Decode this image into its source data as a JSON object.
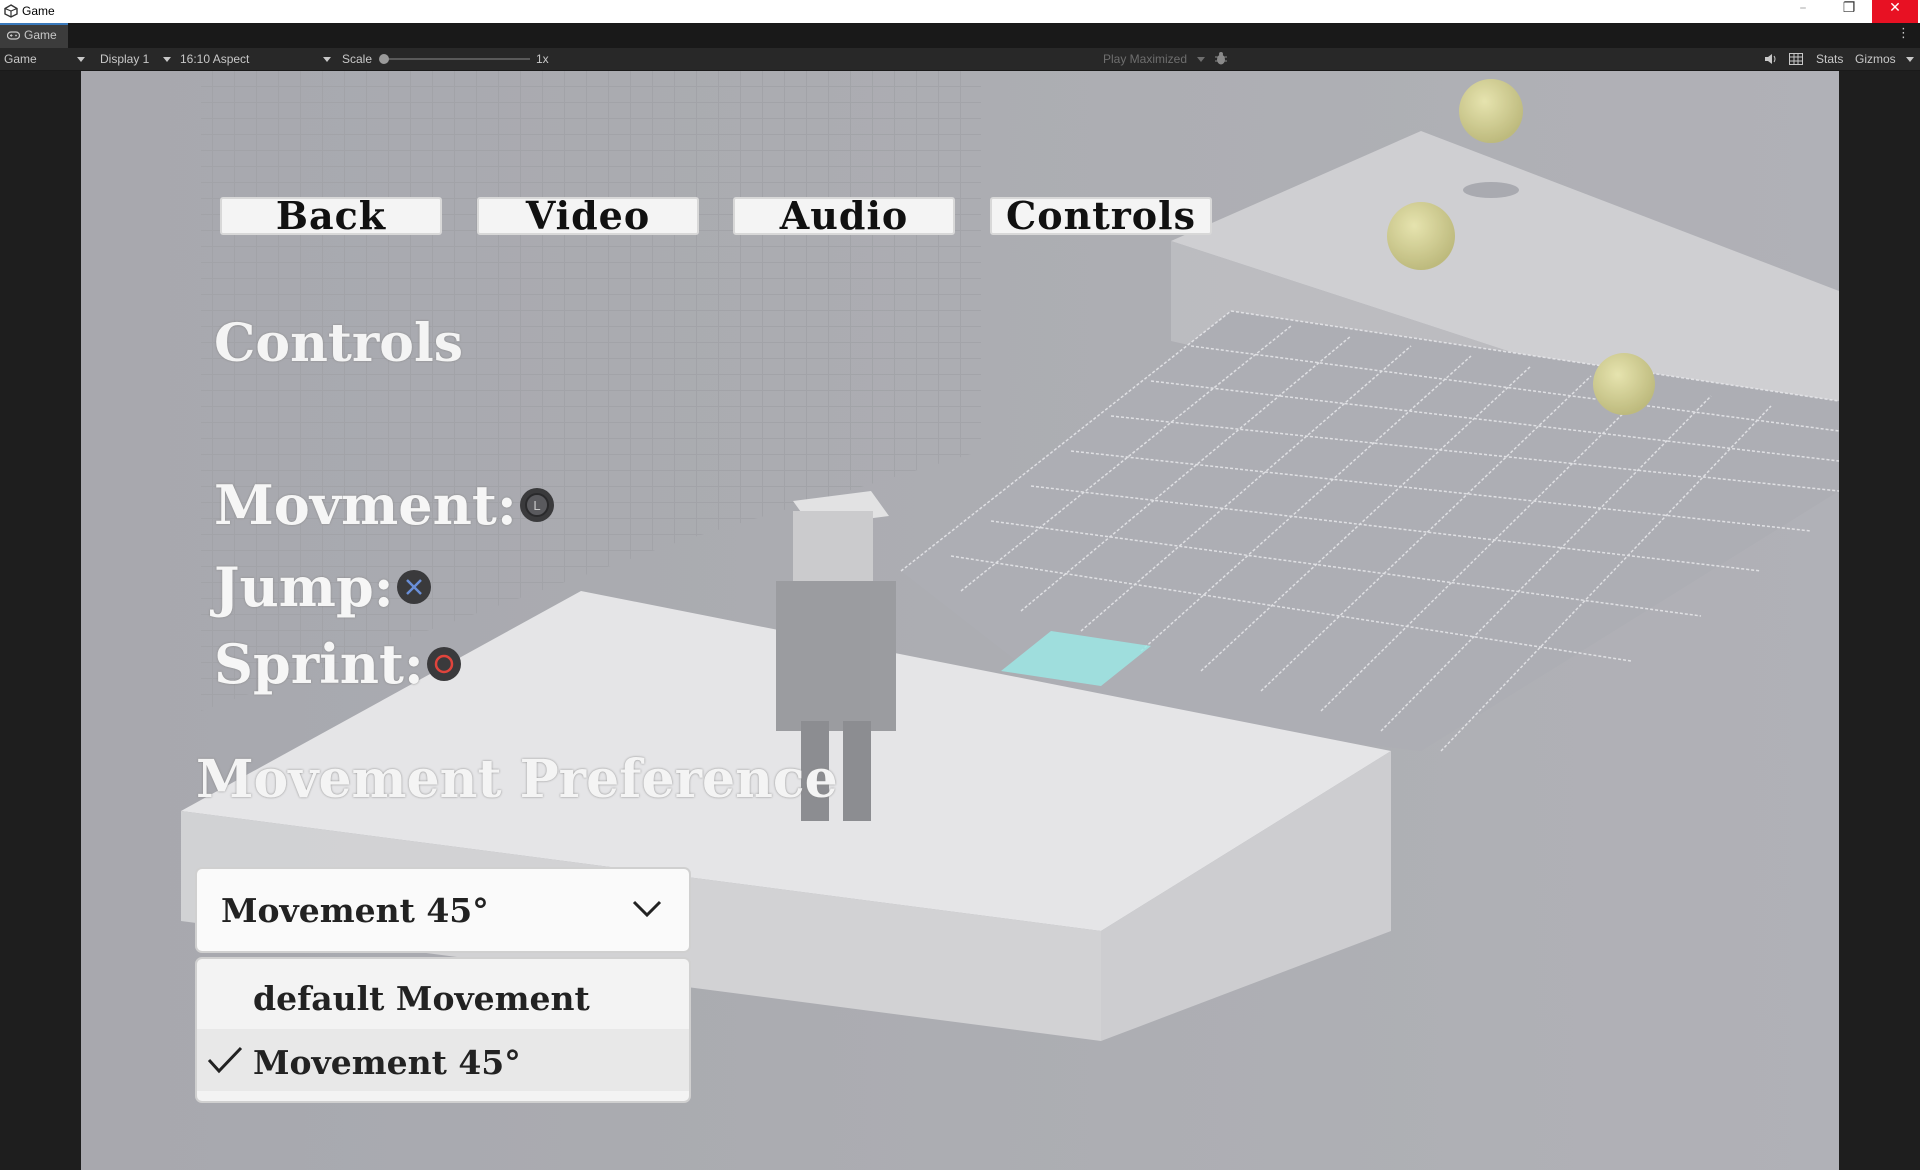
{
  "window": {
    "title": "Game"
  },
  "tab": {
    "label": "Game"
  },
  "toolbar": {
    "view_select": "Game",
    "display": "Display 1",
    "aspect": "16:10 Aspect",
    "scale_label": "Scale",
    "scale_value": "1x",
    "play_mode": "Play Maximized",
    "stats": "Stats",
    "gizmos": "Gizmos"
  },
  "menu": {
    "back": "Back",
    "video": "Video",
    "audio": "Audio",
    "controls": "Controls"
  },
  "page": {
    "title": "Controls",
    "bindings": [
      {
        "label": "Movment:",
        "icon": "left-stick-icon"
      },
      {
        "label": "Jump:",
        "icon": "cross-button-icon"
      },
      {
        "label": "Sprint:",
        "icon": "circle-button-icon"
      }
    ],
    "preference_title": "Movement Preference",
    "dropdown": {
      "selected": "Movement 45°",
      "options": [
        "default Movement",
        "Movement 45°"
      ],
      "checked_index": 1
    }
  },
  "colors": {
    "cross_button": "#6a8fd8",
    "circle_button": "#e0443c",
    "highlight_tile": "#8fe4e2"
  }
}
